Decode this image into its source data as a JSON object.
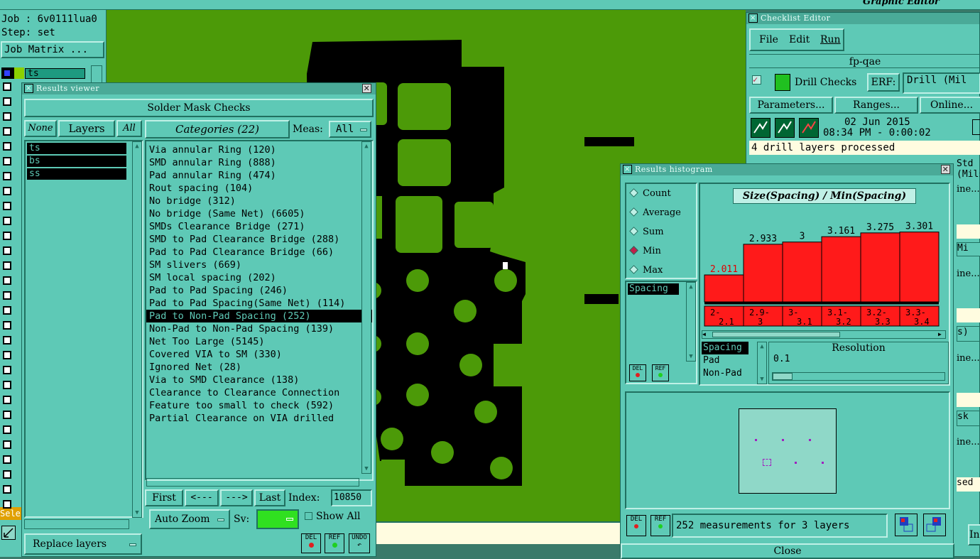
{
  "job": {
    "job_label": "Job : 6v0111lua0",
    "step_label": "Step: set",
    "matrix_button": "Job Matrix ...",
    "first_layer": "ts"
  },
  "graphic_editor": {
    "title": "Graphic Editor",
    "sel_label": "Sele"
  },
  "results_viewer": {
    "title": "Results viewer",
    "header": "Solder Mask Checks",
    "none_btn": "None",
    "layers_btn": "Layers",
    "all_btn": "All",
    "layers": [
      "ts",
      "bs",
      "ss"
    ],
    "categories_btn": "Categories (22)",
    "meas_label": "Meas:",
    "meas_value": "All",
    "categories": [
      "Via annular Ring (120)",
      "SMD annular Ring (888)",
      "Pad annular Ring (474)",
      "Rout spacing (104)",
      "No bridge (312)",
      "No bridge (Same Net) (6605)",
      "SMDs Clearance Bridge (271)",
      "SMD to Pad Clearance Bridge (288)",
      "Pad to Pad Clearance Bridge (66)",
      "SM slivers (669)",
      "SM local spacing (202)",
      "Pad to Pad Spacing (246)",
      "Pad to Pad Spacing(Same Net) (114)",
      "Pad to Non-Pad Spacing (252)",
      "Non-Pad to Non-Pad Spacing (139)",
      "Net Too Large (5145)",
      "Covered VIA to SM (330)",
      "Ignored Net (28)",
      "Via to SMD Clearance (138)",
      "Clearance to Clearance Connection",
      "Feature too small to check (592)",
      "Partial Clearance on VIA drilled"
    ],
    "selected_index": 13,
    "first_btn": "First",
    "prev_btn": "<---",
    "next_btn": "--->",
    "last_btn": "Last",
    "index_label": "Index:",
    "index_value": "10850",
    "autozoom_btn": "Auto Zoom",
    "sv_label": "Sv:",
    "showall_label": "Show All",
    "replace_btn": "Replace layers",
    "del": "DEL",
    "ref": "REF",
    "undo": "UNDO"
  },
  "checklist": {
    "title": "Checklist Editor",
    "menu": [
      "File",
      "Edit",
      "Run"
    ],
    "name": "fp-qae",
    "drill_checks": "Drill Checks",
    "erf_label": "ERF:",
    "erf_value": "Drill (Mil",
    "params_btn": "Parameters...",
    "ranges_btn": "Ranges...",
    "online_btn": "Online...",
    "date": "02 Jun 2015",
    "time": "08:34 PM - 0:00:02",
    "status": "4 drill layers processed",
    "partial": [
      "Std (Mils)",
      "ine...",
      "Mi",
      "ine...",
      "s)",
      "ine...",
      "sk",
      "ine...",
      "sed",
      "In"
    ]
  },
  "histogram": {
    "title": "Results histogram",
    "modes": [
      "Count",
      "Average",
      "Sum",
      "Min",
      "Max"
    ],
    "selected_mode": "Min",
    "chart_title": "Size(Spacing) / Min(Spacing)",
    "attribute": "Spacing",
    "attrs": [
      "Spacing",
      "Pad",
      "Non-Pad"
    ],
    "resolution_label": "Resolution",
    "resolution_value": "0.1",
    "measurements": "252 measurements for 3 layers",
    "close_btn": "Close",
    "bar_color": "#ff1a1a",
    "highlight_color": "#e00000"
  },
  "chart_data": {
    "type": "bar",
    "title": "Size(Spacing) / Min(Spacing)",
    "categories": [
      "2-\n2.1",
      "2.9-\n3",
      "3-\n3.1",
      "3.1-\n3.2",
      "3.2-\n3.3",
      "3.3-\n3.4"
    ],
    "values": [
      2.011,
      2.933,
      3,
      3.161,
      3.275,
      3.301
    ],
    "value_labels": [
      "2.011",
      "2.933",
      "3",
      "3.161",
      "3.275",
      "3.301"
    ],
    "ylim": [
      0,
      3.6
    ]
  }
}
